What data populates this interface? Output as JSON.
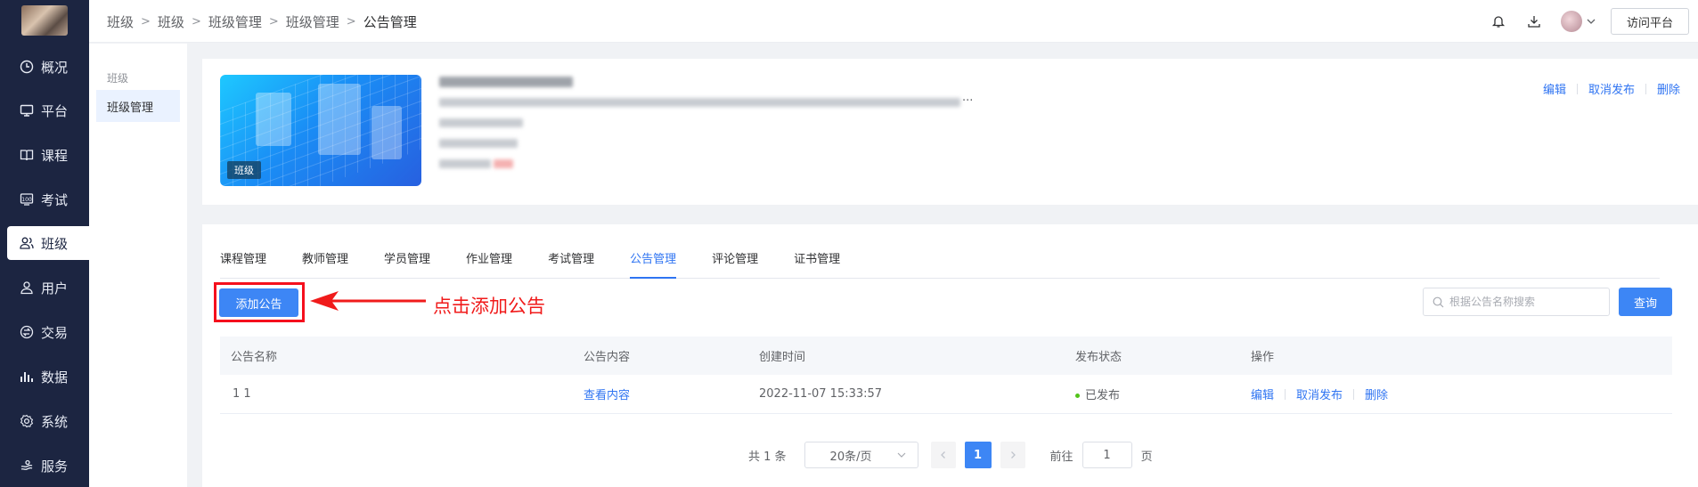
{
  "nav": {
    "items": [
      {
        "label": "概况",
        "icon": "clock-icon"
      },
      {
        "label": "平台",
        "icon": "monitor-icon"
      },
      {
        "label": "课程",
        "icon": "book-icon"
      },
      {
        "label": "考试",
        "icon": "exam-icon"
      },
      {
        "label": "班级",
        "icon": "users-icon"
      },
      {
        "label": "用户",
        "icon": "user-icon"
      },
      {
        "label": "交易",
        "icon": "trade-icon"
      },
      {
        "label": "数据",
        "icon": "bar-chart-icon"
      },
      {
        "label": "系统",
        "icon": "gear-icon"
      },
      {
        "label": "服务",
        "icon": "service-icon"
      }
    ],
    "active_index": 4
  },
  "breadcrumb": [
    "班级",
    "班级",
    "班级管理",
    "班级管理",
    "公告管理"
  ],
  "header": {
    "visit_label": "访问平台"
  },
  "subside": {
    "title": "班级",
    "item": "班级管理"
  },
  "card": {
    "badge": "班级",
    "actions": {
      "edit": "编辑",
      "unpublish": "取消发布",
      "delete": "删除"
    },
    "detail_suffix": "..."
  },
  "tabs": [
    "课程管理",
    "教师管理",
    "学员管理",
    "作业管理",
    "考试管理",
    "公告管理",
    "评论管理",
    "证书管理"
  ],
  "active_tab": 5,
  "toolbar": {
    "add_label": "添加公告",
    "annotation": "点击添加公告",
    "search_placeholder": "根据公告名称搜索",
    "query_label": "查询"
  },
  "table": {
    "headers": [
      "公告名称",
      "公告内容",
      "创建时间",
      "发布状态",
      "操作"
    ],
    "rows": [
      {
        "name": "1 1",
        "content_link": "查看内容",
        "created": "2022-11-07 15:33:57",
        "status": "已发布",
        "actions": {
          "edit": "编辑",
          "unpublish": "取消发布",
          "delete": "删除"
        }
      }
    ]
  },
  "pager": {
    "total": "共 1 条",
    "page_size": "20条/页",
    "current": "1",
    "goto_prefix": "前往",
    "goto_value": "1",
    "goto_suffix": "页"
  },
  "colors": {
    "nav_bg": "#1c2541",
    "primary": "#3d86f5",
    "annotation_red": "#f01b1b"
  }
}
